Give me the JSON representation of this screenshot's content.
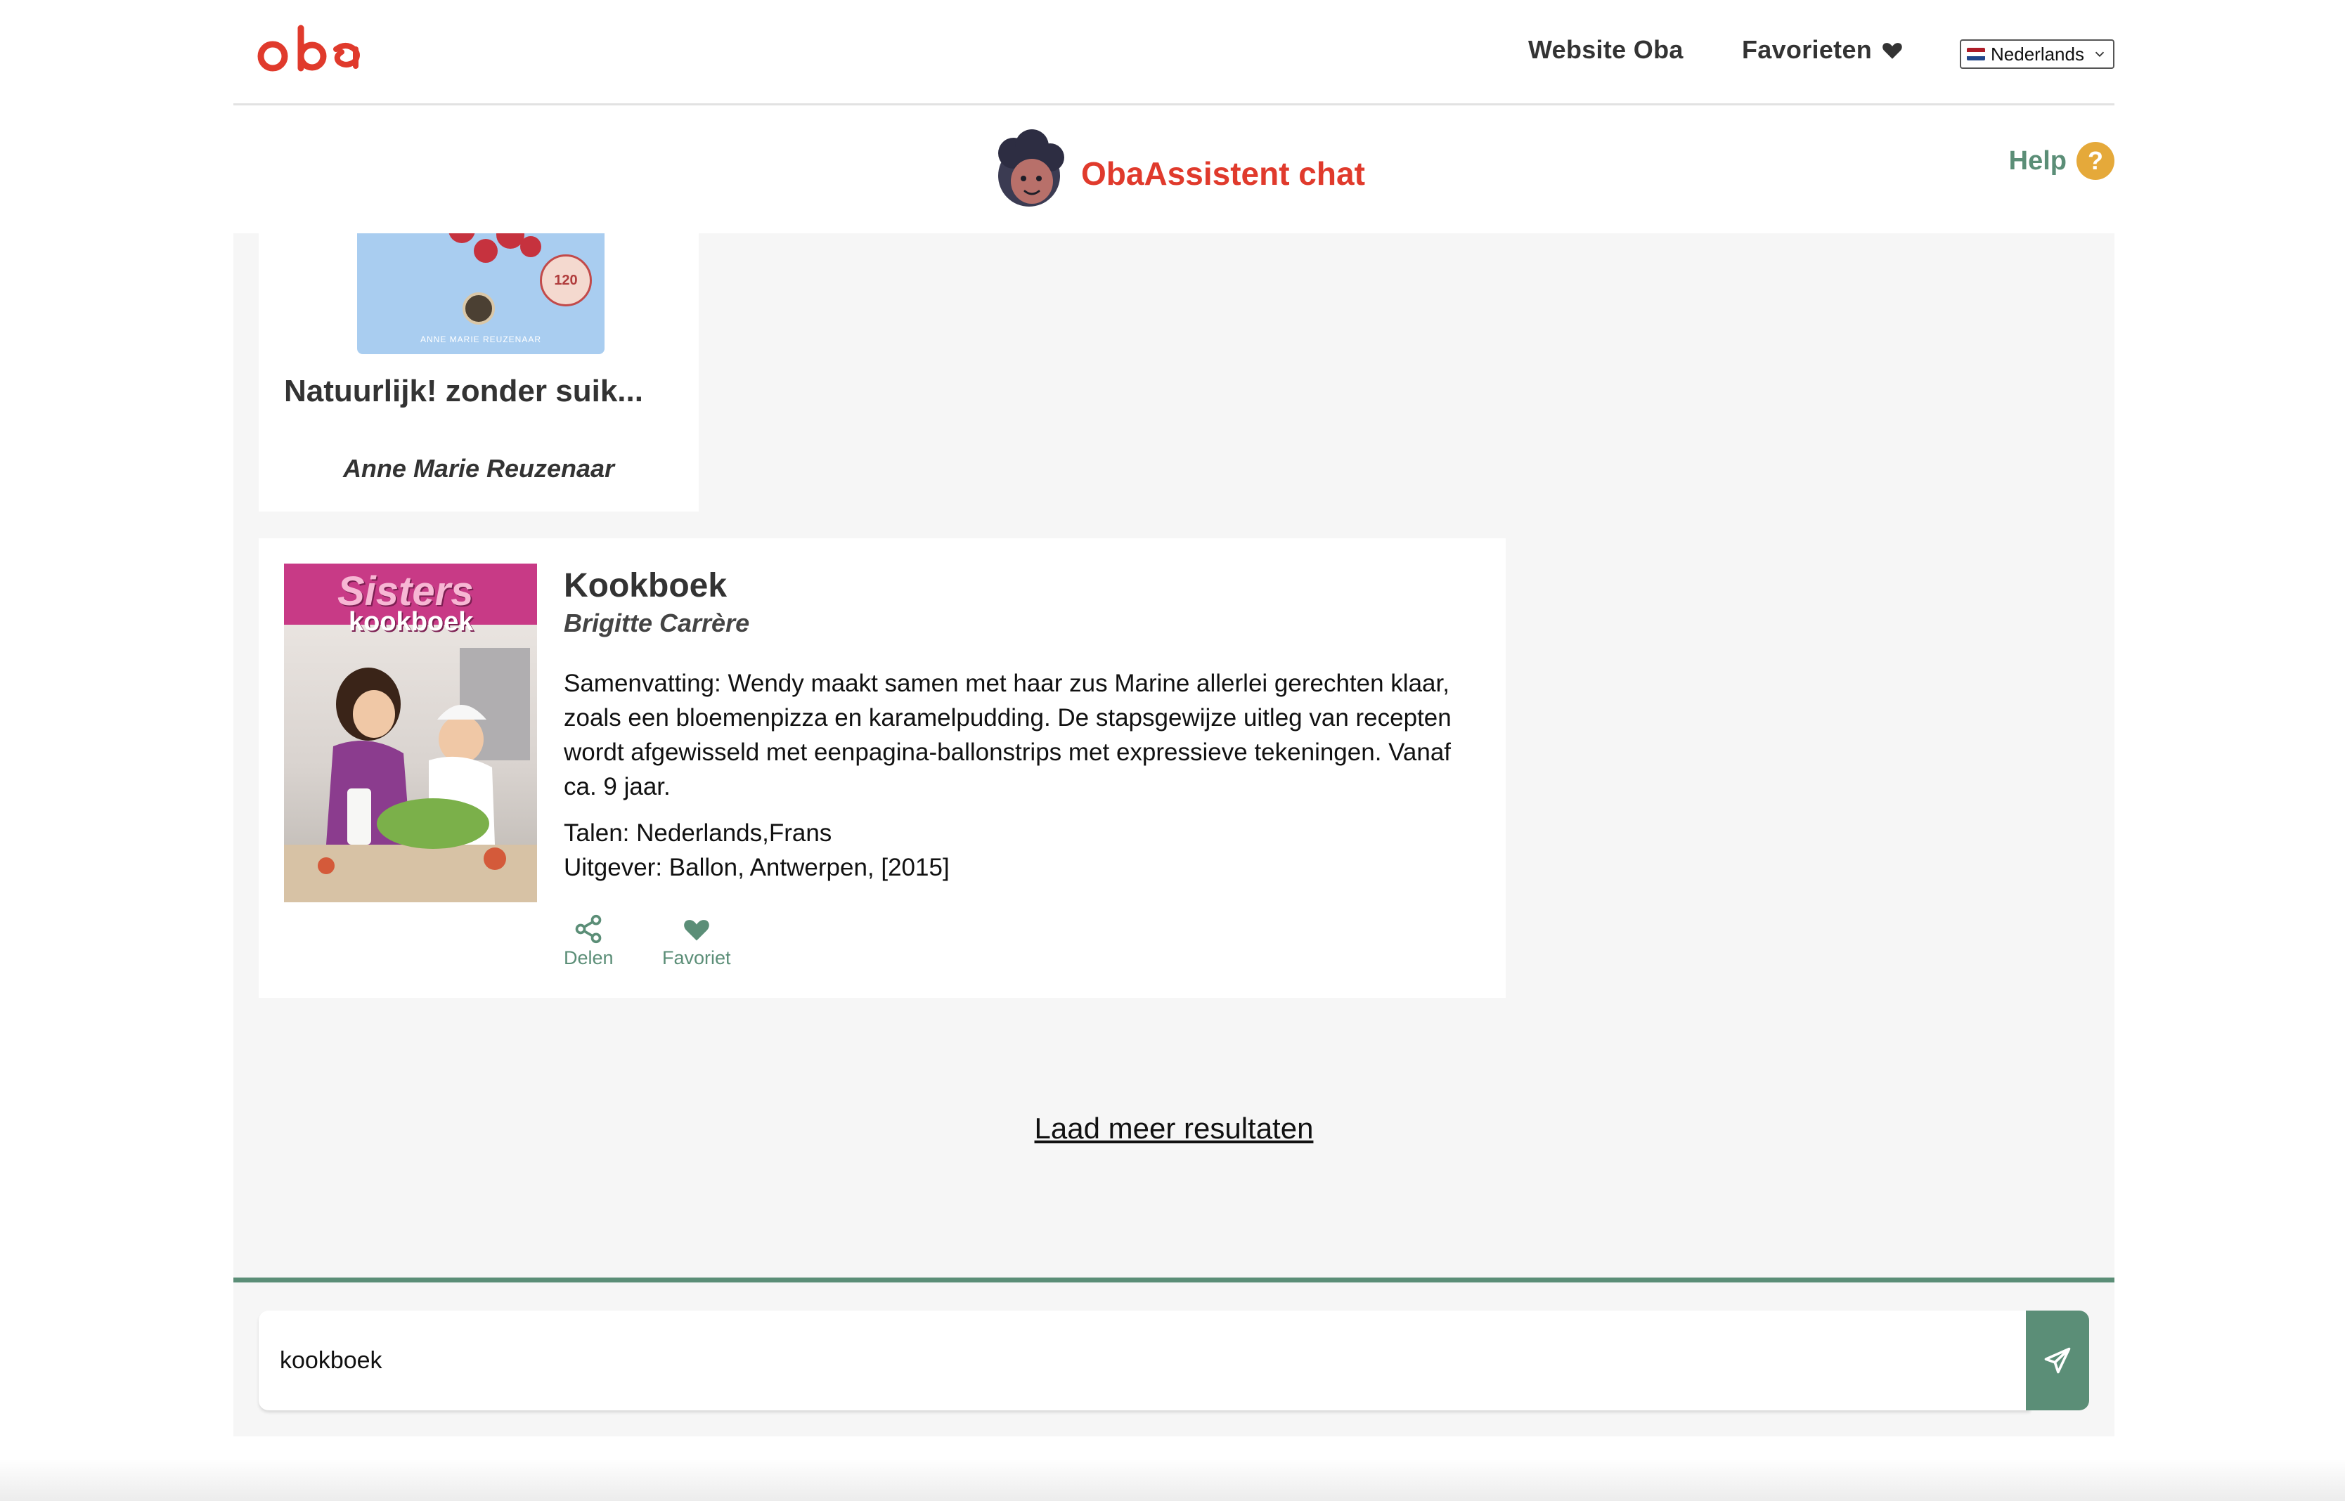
{
  "header": {
    "logo_text": "oba",
    "nav": {
      "website": "Website Oba",
      "favorites": "Favorieten"
    },
    "language": {
      "selected": "Nederlands"
    }
  },
  "chat_header": {
    "title": "ObaAssistent chat",
    "help_label": "Help",
    "help_icon_text": "?"
  },
  "results": [
    {
      "title": "Natuurlijk! zonder suik...",
      "author": "Anne Marie Reuzenaar",
      "cover_caption": "ANNE MARIE REUZENAAR",
      "cover_badge": "120"
    },
    {
      "title": "Kookboek",
      "author": "Brigitte Carrère",
      "cover_title": "Sisters",
      "cover_subtitle": "kookboek",
      "summary": "Samenvatting: Wendy maakt samen met haar zus Marine allerlei gerechten klaar, zoals een bloemenpizza en karamelpudding. De stapsgewijze uitleg van recepten wordt afgewisseld met eenpagina-ballonstrips met expressieve tekeningen. Vanaf ca. 9 jaar.",
      "languages": "Talen: Nederlands,Frans",
      "publisher": "Uitgever: Ballon, Antwerpen, [2015]",
      "actions": {
        "share": "Delen",
        "favorite": "Favoriet"
      }
    }
  ],
  "load_more": "Laad meer resultaten",
  "input": {
    "value": "kookboek"
  },
  "colors": {
    "brand_red": "#e03a2c",
    "accent_green": "#5b8e77",
    "help_orange": "#e5a93a",
    "chat_background": "#f6f6f6"
  }
}
